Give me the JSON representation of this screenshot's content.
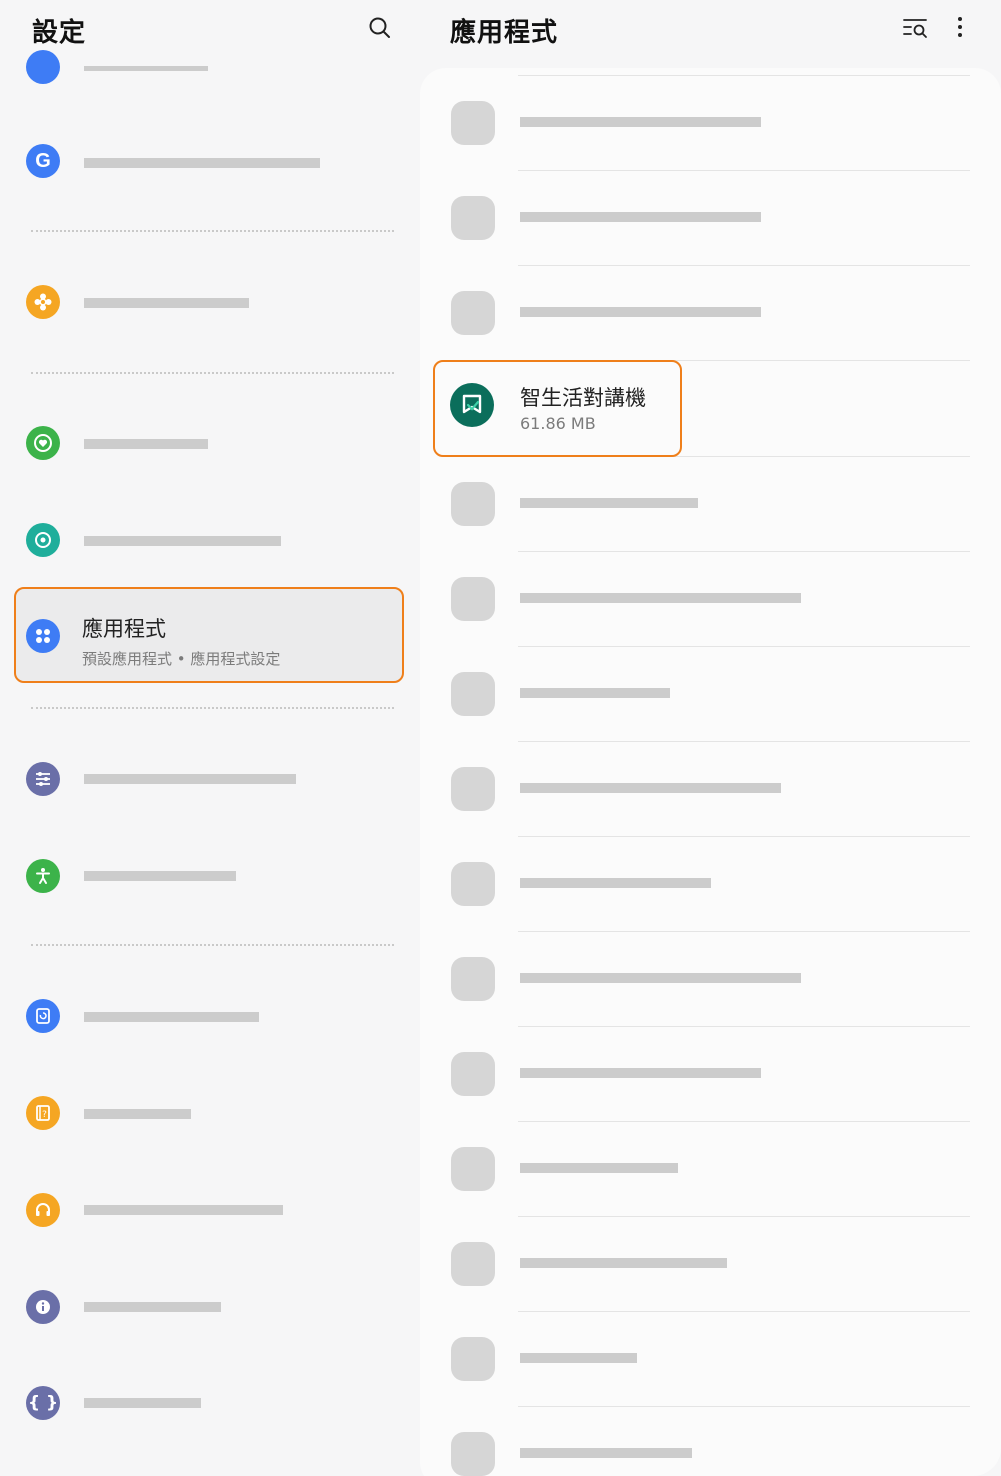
{
  "left_pane": {
    "title": "設定",
    "selected_item": {
      "label": "應用程式",
      "subtitle": "預設應用程式 • 應用程式設定"
    }
  },
  "right_pane": {
    "title": "應用程式",
    "highlighted_app": {
      "name": "智生活對講機",
      "size": "61.86 MB"
    }
  },
  "colors": {
    "highlight_border": "#ef7f1a",
    "placeholder_bar": "#cccccc",
    "app_icon": "#0b6e5b"
  },
  "icons": {
    "left": [
      "partial-icon",
      "google-icon",
      "gear-flower-icon",
      "heart-ring-icon",
      "backup-restore-icon",
      "apps-grid-icon",
      "sliders-icon",
      "accessibility-icon",
      "sync-icon",
      "tips-icon",
      "headset-icon",
      "info-icon",
      "braces-icon"
    ],
    "right_toolbar": [
      "search-list-icon",
      "more-vert-icon"
    ]
  }
}
